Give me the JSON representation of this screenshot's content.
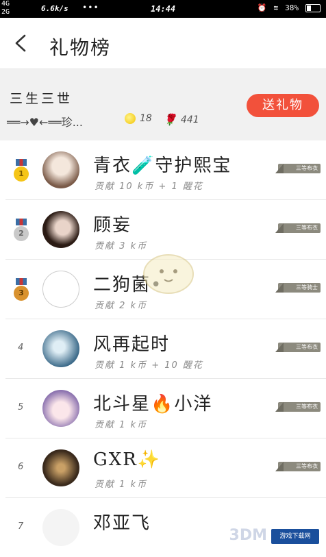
{
  "status": {
    "network_top": "4G",
    "network_bottom": "2G",
    "speed": "6.6k/s",
    "dots": "•••",
    "time": "14:44",
    "battery": "38%"
  },
  "header": {
    "back_icon": "chevron-left-icon",
    "title": "礼物榜"
  },
  "banner": {
    "name": "三生三世",
    "subtitle": "══→♥←══珍...",
    "coins": "18",
    "roses": "441",
    "gift_button": "送礼物"
  },
  "ranks": [
    {
      "rank": "1",
      "name": "青衣🧪守护熙宝",
      "contrib": "贡献 10 k币 + 1 醒花",
      "badge": "三等布衣"
    },
    {
      "rank": "2",
      "name": "顾妄",
      "contrib": "贡献 3 k币",
      "badge": "三等布衣"
    },
    {
      "rank": "3",
      "name": "二狗菌•",
      "contrib": "贡献 2 k币",
      "badge": "三等骑士"
    },
    {
      "rank": "4",
      "name": "风再起时",
      "contrib": "贡献 1 k币 + 10 醒花",
      "badge": "三等布衣"
    },
    {
      "rank": "5",
      "name": "北斗星🔥小洋",
      "contrib": "贡献 1 k币",
      "badge": "三等布衣"
    },
    {
      "rank": "6",
      "name": "GXR✨",
      "contrib": "贡献 1 k币",
      "badge": "三等布衣"
    },
    {
      "rank": "7",
      "name": "邓亚飞",
      "contrib": "",
      "badge": ""
    }
  ],
  "watermark": {
    "brand": "3DM",
    "site": "游戏下载网"
  }
}
